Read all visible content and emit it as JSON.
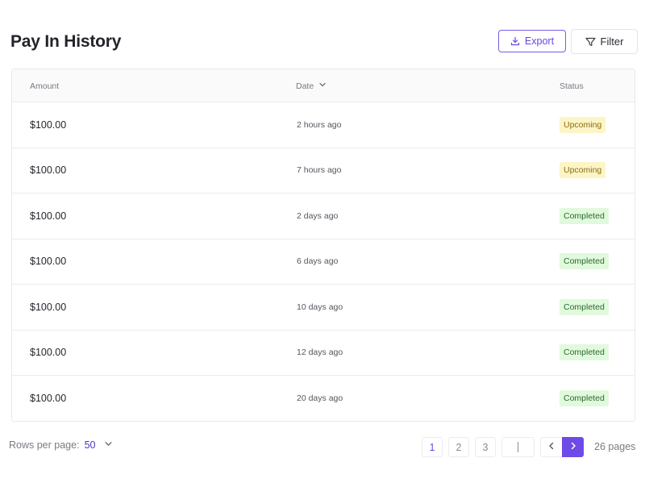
{
  "header": {
    "title": "Pay In History",
    "export_label": "Export",
    "filter_label": "Filter"
  },
  "table": {
    "columns": {
      "amount": "Amount",
      "date": "Date",
      "status": "Status"
    },
    "sort_column": "Date",
    "rows": [
      {
        "amount": "$100.00",
        "date": "2 hours ago",
        "status": "Upcoming"
      },
      {
        "amount": "$100.00",
        "date": "7 hours ago",
        "status": "Upcoming"
      },
      {
        "amount": "$100.00",
        "date": "2 days ago",
        "status": "Completed"
      },
      {
        "amount": "$100.00",
        "date": "6 days ago",
        "status": "Completed"
      },
      {
        "amount": "$100.00",
        "date": "10 days ago",
        "status": "Completed"
      },
      {
        "amount": "$100.00",
        "date": "12 days ago",
        "status": "Completed"
      },
      {
        "amount": "$100.00",
        "date": "20 days ago",
        "status": "Completed"
      }
    ]
  },
  "pagination": {
    "rows_per_page_label": "Rows per page:",
    "rows_per_page_value": "50",
    "pages": [
      "1",
      "2",
      "3"
    ],
    "current_page": "1",
    "page_input_value": "",
    "total_pages_label": "26 pages"
  },
  "colors": {
    "accent": "#6e4ae6",
    "upcoming_bg": "#fdf5c6",
    "upcoming_text": "#8a6d12",
    "completed_bg": "#e1f9dc",
    "completed_text": "#2a6b2f"
  },
  "icons": {
    "export": "download-icon",
    "filter": "filter-funnel-icon",
    "sort": "chevron-down-icon",
    "rows_per_page": "chevron-down-icon",
    "prev": "chevron-left-icon",
    "next": "chevron-right-icon"
  }
}
